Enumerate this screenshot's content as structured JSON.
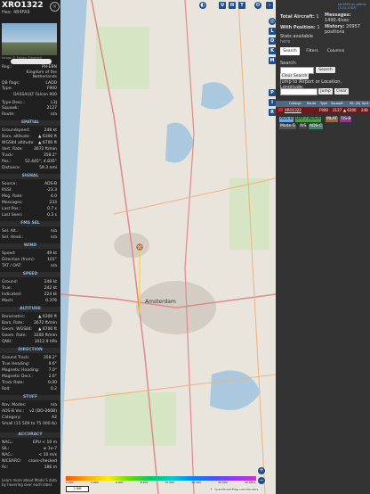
{
  "left": {
    "callsign": "XRO1322",
    "hex": "Hex: 484FA9",
    "photo_credit": "Image © Fabian Zimmerli",
    "reg_label": "Reg.:",
    "reg": "PH-EBN",
    "country": "Kingdom of the Netherlands",
    "db_flags_label": "DB flags:",
    "db_flags": "LADD",
    "type_label": "Type:",
    "type": "F900",
    "model": "DASSAULT Falcon 900",
    "type_desc_label": "Type Desc.:",
    "type_desc": "L3J",
    "squawk_label": "Squawk:",
    "squawk": "2127",
    "route_label": "Route:",
    "route": "n/a",
    "sec_spatial": "SPATIAL",
    "groundspeed_label": "Groundspeed:",
    "groundspeed": "248 kt",
    "baro_alt_label": "Baro. altitude:",
    "baro_alt": "▲ 6300 ft",
    "wgs_alt_label": "WGS84 altitude:",
    "wgs_alt": "▲ 6700 ft",
    "vert_rate_label": "Vert. Rate:",
    "vert_rate": "3672 ft/min",
    "track_label": "Track:",
    "track": "358.2°",
    "pos_label": "Pos.:",
    "pos": "52.445°, 4.835°",
    "distance_label": "Distance:",
    "distance": "59.3 nmi",
    "sec_signal": "SIGNAL",
    "source_label": "Source:",
    "source": "ADS-B",
    "rssi_label": "RSSI:",
    "rssi": "-23.3",
    "msg_rate_label": "Msg. Rate:",
    "msg_rate": "4.0",
    "messages_label": "Messages:",
    "messages": "233",
    "last_pos_label": "Last Pos.:",
    "last_pos": "0.7 s",
    "last_seen_label": "Last Seen:",
    "last_seen": "0.3 s",
    "sec_fms": "FMS SEL",
    "sel_alt_label": "Sel. Alt.:",
    "sel_alt": "n/a",
    "sel_head_label": "Sel. Head.:",
    "sel_head": "n/a",
    "sec_wind": "WIND",
    "wind_speed_label": "Speed:",
    "wind_speed": "49 kt",
    "wind_dir_label": "Direction (from):",
    "wind_dir": "101°",
    "tat_label": "TAT / OAT:",
    "tat": "n/a",
    "sec_speed": "SPEED",
    "ground_label": "Ground:",
    "ground": "248 kt",
    "true_label": "True:",
    "true": "242 kt",
    "indicated_label": "Indicated:",
    "indicated": "224 kt",
    "mach_label": "Mach:",
    "mach": "0.376",
    "sec_altitude": "ALTITUDE",
    "barometric_label": "Barometric:",
    "barometric": "▲ 6300 ft",
    "baro_rate_label": "Baro. Rate:",
    "baro_rate": "3672 ft/min",
    "geom_wgs_label": "Geom. WGS84:",
    "geom_wgs": "▲ 6700 ft",
    "geom_rate_label": "Geom. Rate:",
    "geom_rate": "3200 ft/min",
    "qnh_label": "QNH:",
    "qnh": "1012.9 hPa",
    "sec_direction": "DIRECTION",
    "ground_track_label": "Ground Track:",
    "ground_track": "358.2°",
    "true_heading_label": "True Heading:",
    "true_heading": "9.6°",
    "mag_heading_label": "Magnetic Heading:",
    "mag_heading": "7.0°",
    "mag_decl_label": "Magnetic Decl.:",
    "mag_decl": "2.6°",
    "track_rate_label": "Track Rate:",
    "track_rate": "0.00",
    "roll_label": "Roll:",
    "roll": "0.2",
    "sec_stuff": "STUFF",
    "nav_modes_label": "Nav. Modes:",
    "nav_modes": "n/a",
    "adsb_ver_label": "ADS-B Ver.:",
    "adsb_ver": "v2 (DO-260B)",
    "category_label": "Category:",
    "category": "A2",
    "category_desc": "Small (15 500 to 75 000 lb)",
    "sec_accuracy": "ACCURACY",
    "nacp_label": "NACₚ:",
    "nacp": "EPU < 10 m",
    "sil_label": "SIL:",
    "sil": "≤ 1e-7",
    "nacv_label": "NACᵥ:",
    "nacv": "< 10 m/s",
    "nicbaro_label": "NICBARO:",
    "nicbaro": "cross-checked",
    "rc_label": "Rc:",
    "rc": "186 m",
    "footer": "Learn more about Mode S data by hovering over each label."
  },
  "map": {
    "btn_u": "U",
    "btn_h": "H",
    "btn_t": "T",
    "side_buttons": [
      "L",
      "O",
      "K",
      "M",
      "P",
      "I",
      "R"
    ],
    "city": "Amsterdam",
    "scale": "2 NM",
    "attribution": "© OpenStreetMap contributors.",
    "alt_ticks": [
      "2 000",
      "4 000",
      "6 000",
      "8 000",
      "10 000",
      "20 000",
      "30 000",
      "40 000+"
    ],
    "zoom_in": "+",
    "zoom_out": "−"
  },
  "right": {
    "gh_link": "tar1090 on github (3.14.1787)",
    "total_label": "Total Aircraft:",
    "total": "1",
    "with_pos_label": "With Position:",
    "with_pos": "1",
    "messages_label": "Messages:",
    "messages_rate": "1490.4/sec",
    "history_label": "History:",
    "history": "20957 positions",
    "stats_label": "Stats available",
    "stats_link": "here",
    "tab_search": "Search",
    "tab_filters": "Filters",
    "tab_columns": "Columns",
    "search_label": "Search:",
    "search_btn": "Search",
    "clear_search": "Clear Search",
    "jump_label": "Jump to Airport or Location, Longitude:",
    "jump_btn": "Jump",
    "clear_btn": "Clear",
    "col_callsign": "Callsign",
    "col_route": "Route",
    "col_type": "Type",
    "col_squawk": "Squawk",
    "col_alt": "Alt. (ft)",
    "col_spd": "Spd.",
    "row_callsign": "XRO1322",
    "row_type": "F900",
    "row_squawk": "2127",
    "row_alt": "▲ 6300",
    "row_spd": "248",
    "chip_adsb": "ADS-B",
    "chip_uat": "UAT / ADS-R",
    "chip_mlat": "MLAT",
    "chip_tisb": "TIS-B",
    "chip_modes": "Mode-S",
    "chip_ais": "AIS",
    "chip_adsc": "ADS-C"
  },
  "colors": {
    "aircraft": "#ffd400",
    "accent": "#1f4e89",
    "row_highlight": "#6a1b1b",
    "chip_adsb": "#6fa8dc",
    "chip_uat": "#4a9b4a",
    "chip_mlat": "#8a6a4a",
    "chip_tisb": "#8a3a8a"
  }
}
